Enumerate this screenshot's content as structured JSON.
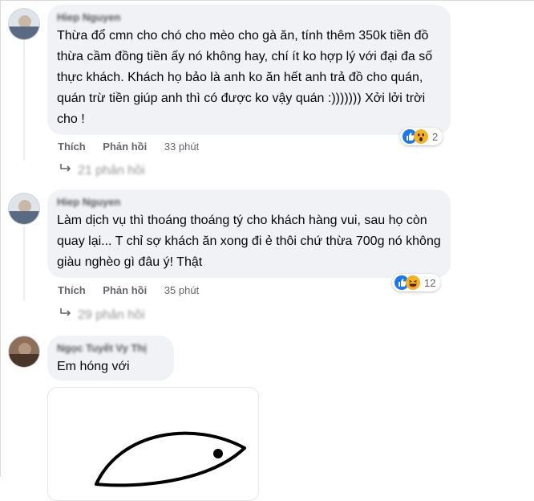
{
  "comments": [
    {
      "author": "Hiep Nguyen",
      "text": "Thừa đổ cmn cho chó cho mèo cho gà ăn, tính thêm 350k tiền đồ thừa cầm đồng tiền ấy nó không hay, chí ít ko hợp lý với đại đa số thực khách. Khách họ bảo là anh ko ăn hết anh trả đồ cho quán, quán trừ tiền giúp anh thì có được ko vậy quán :))))))) Xởi lởi trời cho !",
      "like_label": "Thích",
      "reply_label": "Phản hồi",
      "time": "33 phút",
      "reaction_count": "2",
      "reaction_icons": [
        "like-icon",
        "wow-icon"
      ],
      "replies_count_label": "21 phản hồi"
    },
    {
      "author": "Hiep Nguyen",
      "text": "Làm dịch vụ thì thoáng thoáng tý cho khách hàng vui, sau họ còn quay lại... T chỉ sợ khách ăn xong đi ẻ thôi chứ thừa 700g nó không giàu nghèo gì đâu ý! Thật",
      "like_label": "Thích",
      "reply_label": "Phản hồi",
      "time": "35 phút",
      "reaction_count": "12",
      "reaction_icons": [
        "like-icon",
        "haha-icon"
      ],
      "replies_count_label": "29 phản hồi"
    },
    {
      "author": "Ngọc Tuyết Vy Thị",
      "text": "Em hóng với",
      "sticker_icon": "fish-doodle-icon"
    }
  ],
  "colors": {
    "bubble": "#f0f2f5",
    "secondary_text": "#65676b",
    "like_blue": "#1877f2",
    "haha_yellow": "#f7b125"
  }
}
